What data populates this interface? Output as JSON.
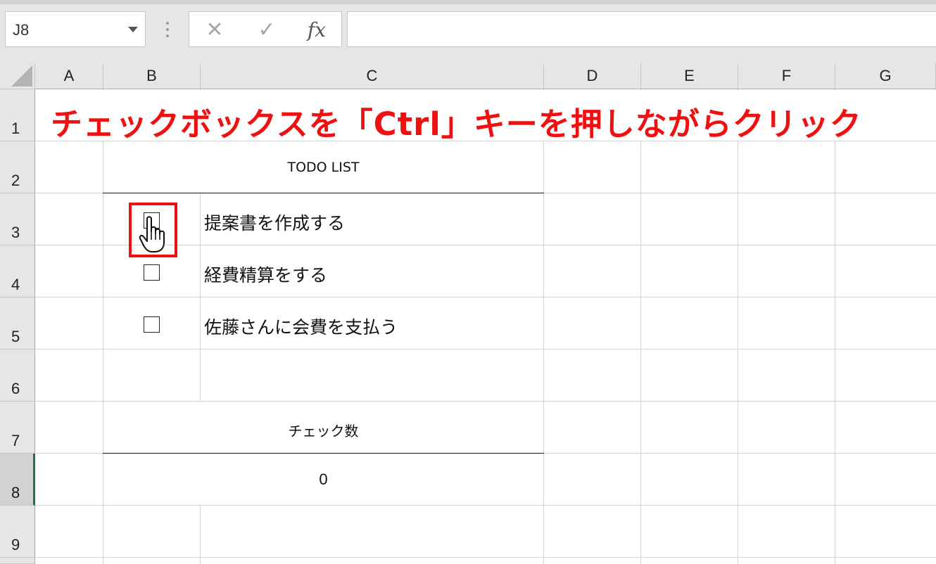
{
  "formula_bar": {
    "name_box": "J8",
    "cancel_glyph": "✕",
    "enter_glyph": "✓",
    "fx_label": "fx",
    "formula": ""
  },
  "columns": [
    "A",
    "B",
    "C",
    "D",
    "E",
    "F",
    "G"
  ],
  "rows": [
    "1",
    "2",
    "3",
    "4",
    "5",
    "6",
    "7",
    "8",
    "9"
  ],
  "active_cell": "J8",
  "sheet": {
    "heading": "チェックボックスを「Ctrl」キーを押しながらクリック",
    "todo_title": "TODO LIST",
    "tasks": [
      {
        "label": "提案書を作成する",
        "checked": false
      },
      {
        "label": "経費精算をする",
        "checked": false
      },
      {
        "label": "佐藤さんに会費を支払う",
        "checked": false
      }
    ],
    "check_count_label": "チェック数",
    "check_count_value": "0"
  },
  "colors": {
    "heading": "#ee1111",
    "highlight": "#ee1111",
    "active_row_marker": "#217346"
  },
  "icons": {
    "cursor": "hand-pointer-icon",
    "name_box_dropdown": "dropdown-arrow-icon"
  }
}
